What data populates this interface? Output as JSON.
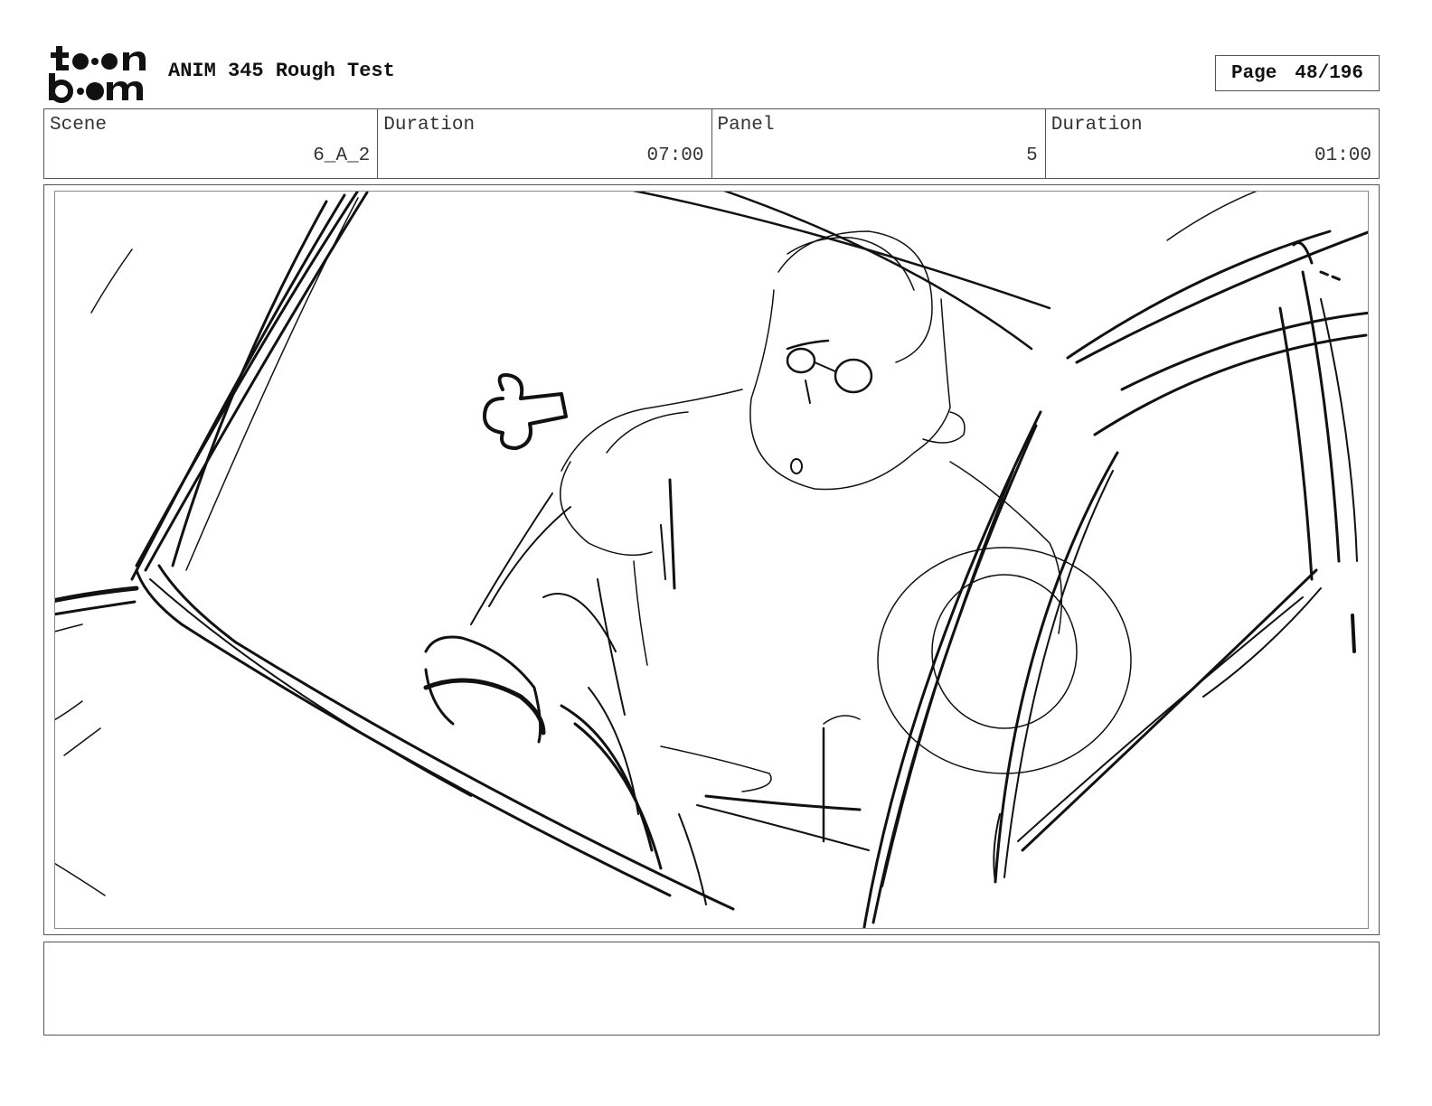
{
  "header": {
    "logo_text": "toon boom",
    "project_title": "ANIM 345 Rough Test",
    "page_label": "Page",
    "page_value": "48/196"
  },
  "info": {
    "scene_label": "Scene",
    "scene_value": "6_A_2",
    "scene_duration_label": "Duration",
    "scene_duration_value": "07:00",
    "panel_label": "Panel",
    "panel_value": "5",
    "panel_duration_label": "Duration",
    "panel_duration_value": "01:00"
  },
  "notes": {
    "text": ""
  }
}
